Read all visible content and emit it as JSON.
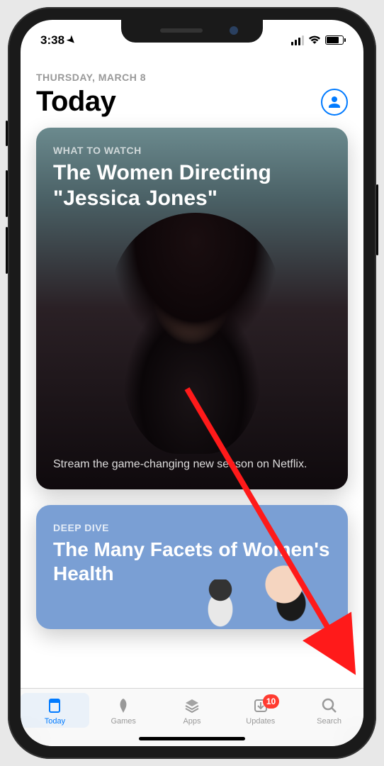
{
  "status": {
    "time": "3:38"
  },
  "header": {
    "date": "THURSDAY, MARCH 8",
    "title": "Today"
  },
  "cards": [
    {
      "kicker": "WHAT TO WATCH",
      "title": "The Women Directing \"Jessica Jones\"",
      "subtitle": "Stream the game-changing new season on Netflix."
    },
    {
      "kicker": "DEEP DIVE",
      "title": "The Many Facets of Women's Health"
    }
  ],
  "tabs": {
    "items": [
      {
        "label": "Today"
      },
      {
        "label": "Games"
      },
      {
        "label": "Apps"
      },
      {
        "label": "Updates",
        "badge": "10"
      },
      {
        "label": "Search"
      }
    ]
  }
}
